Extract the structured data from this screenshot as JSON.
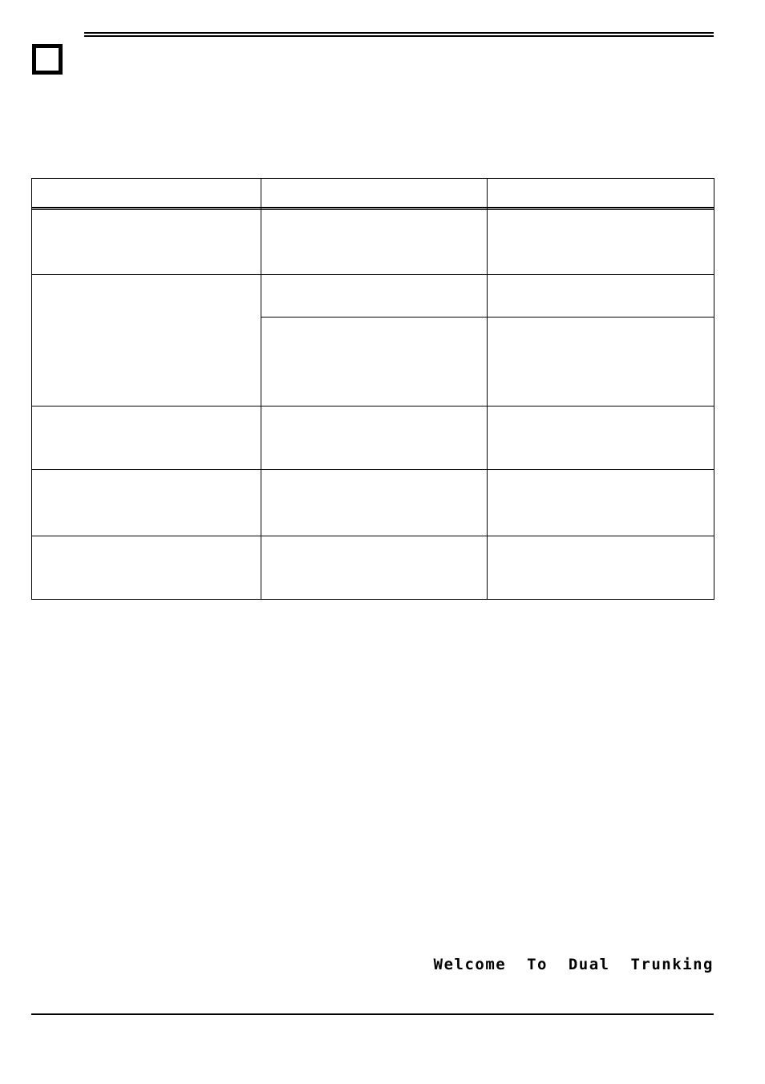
{
  "document": {
    "page_background": "#ffffff",
    "ink_color": "#000000",
    "header": {
      "marker_icon": "page-marker-square-icon",
      "title": "",
      "rule_style": "double"
    },
    "footer": {
      "rule_style": "single",
      "left_text": "",
      "right_text": ""
    }
  },
  "table": {
    "columns": [
      {
        "header": ""
      },
      {
        "header": ""
      },
      {
        "header": ""
      }
    ],
    "rows": [
      {
        "name": "row-1",
        "cells": [
          "",
          "",
          ""
        ]
      },
      {
        "name": "row-2a",
        "cells": [
          "",
          "",
          ""
        ]
      },
      {
        "name": "row-2b",
        "cells": [
          "",
          ""
        ]
      },
      {
        "name": "row-3",
        "cells": [
          "",
          "",
          ""
        ]
      },
      {
        "name": "row-4",
        "cells": [
          "",
          "",
          ""
        ]
      },
      {
        "name": "row-5",
        "cells": [
          "",
          "",
          ""
        ]
      }
    ]
  },
  "lcd_display": {
    "text": "Welcome  To  Dual  Trunking"
  }
}
